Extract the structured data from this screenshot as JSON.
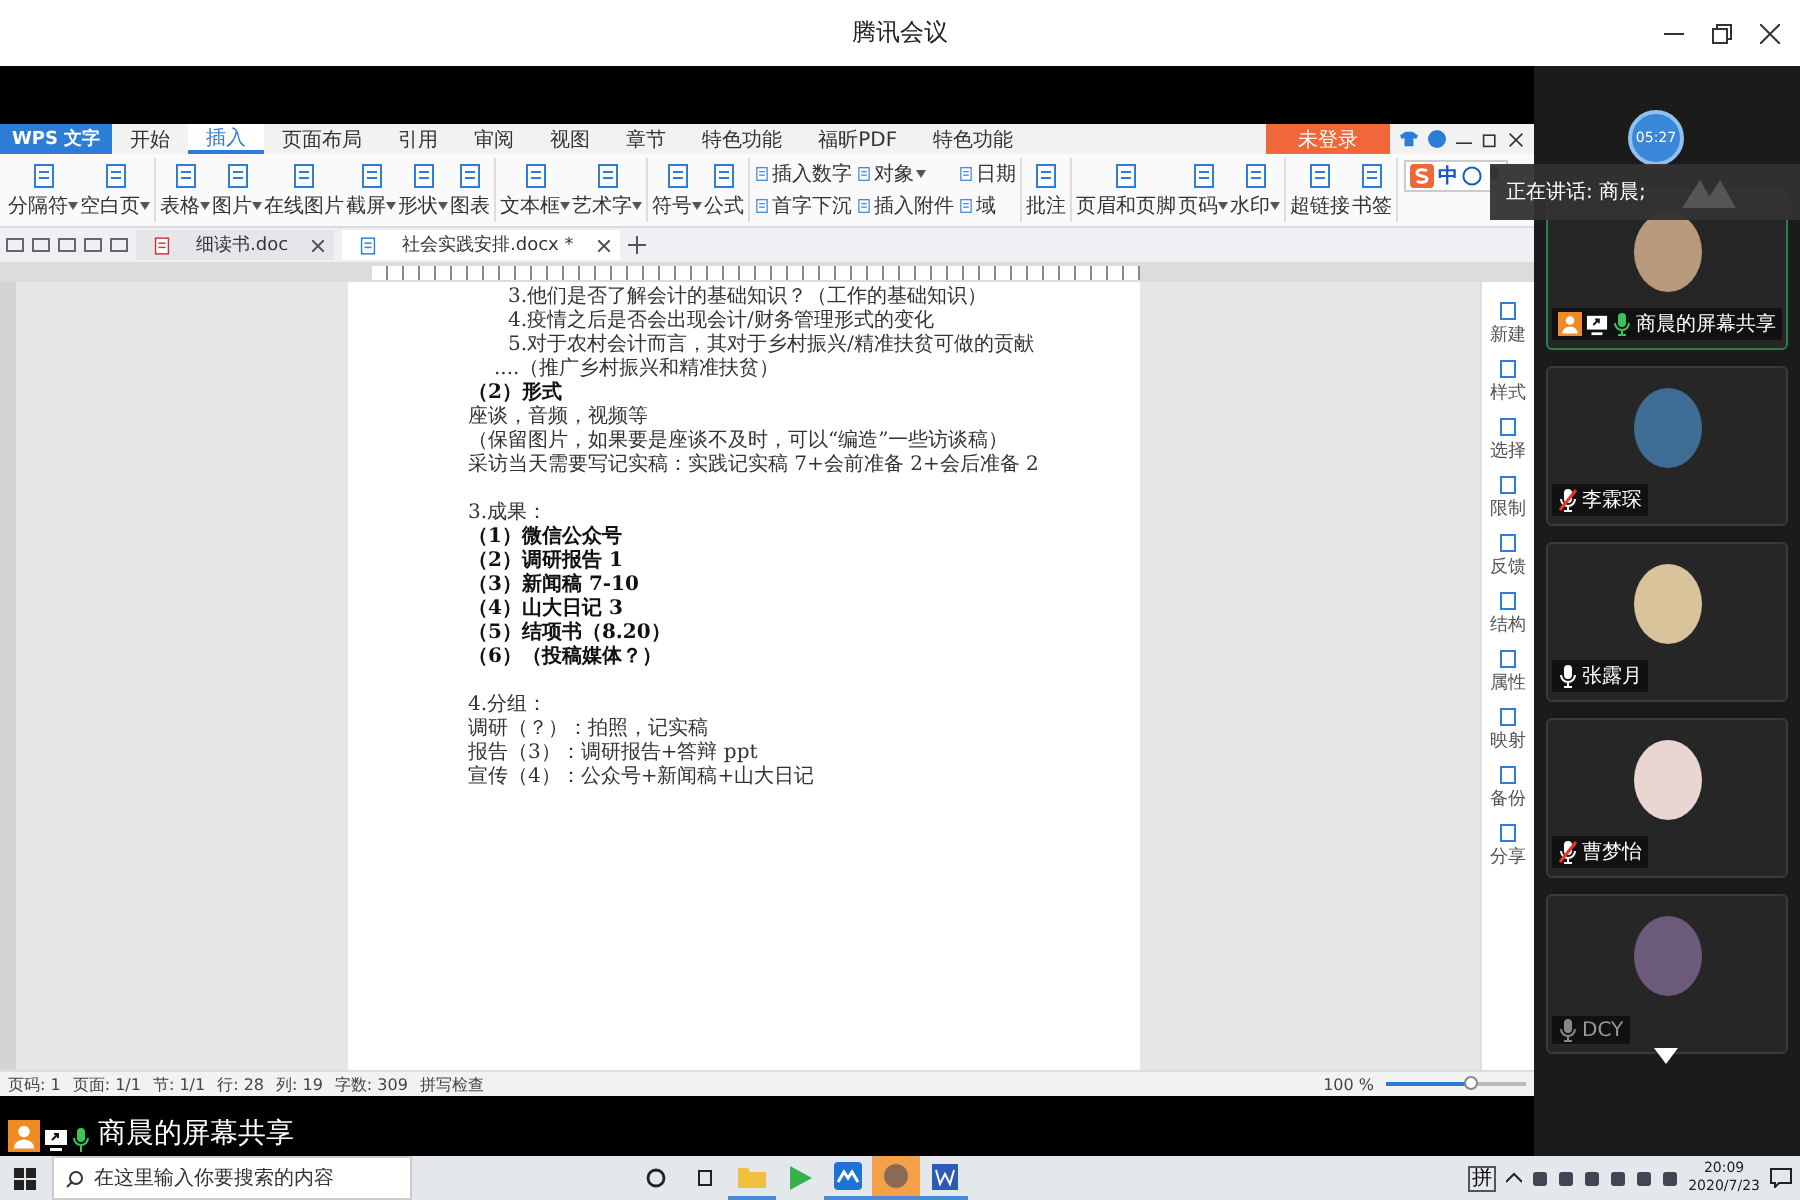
{
  "window": {
    "title": "腾讯会议"
  },
  "wps": {
    "app_tab": "WPS 文字",
    "ribbon_tabs": [
      {
        "label": "开始",
        "selected": false
      },
      {
        "label": "插入",
        "selected": true
      },
      {
        "label": "页面布局",
        "selected": false
      },
      {
        "label": "引用",
        "selected": false
      },
      {
        "label": "审阅",
        "selected": false
      },
      {
        "label": "视图",
        "selected": false
      },
      {
        "label": "章节",
        "selected": false
      },
      {
        "label": "特色功能",
        "selected": false
      },
      {
        "label": "福昕PDF",
        "selected": false
      },
      {
        "label": "特色功能",
        "selected": false
      }
    ],
    "login": "未登录",
    "tool_groups": [
      {
        "kind": "large",
        "items": [
          {
            "label": "分隔符",
            "dropdown": true
          },
          {
            "label": "空白页",
            "dropdown": true
          }
        ]
      },
      {
        "kind": "large",
        "items": [
          {
            "label": "表格",
            "dropdown": true
          },
          {
            "label": "图片",
            "dropdown": true
          },
          {
            "label": "在线图片",
            "dropdown": false
          },
          {
            "label": "截屏",
            "dropdown": true
          },
          {
            "label": "形状",
            "dropdown": true
          },
          {
            "label": "图表",
            "dropdown": false
          }
        ]
      },
      {
        "kind": "large",
        "items": [
          {
            "label": "文本框",
            "dropdown": true
          },
          {
            "label": "艺术字",
            "dropdown": true
          }
        ]
      },
      {
        "kind": "large",
        "items": [
          {
            "label": "符号",
            "dropdown": true
          },
          {
            "label": "公式",
            "dropdown": false
          }
        ]
      },
      {
        "kind": "small",
        "items": [
          {
            "label": "插入数字",
            "dropdown": false
          },
          {
            "label": "对象",
            "dropdown": true
          },
          {
            "label": "日期",
            "dropdown": false
          },
          {
            "label": "首字下沉",
            "dropdown": false
          },
          {
            "label": "插入附件",
            "dropdown": false
          },
          {
            "label": "域",
            "dropdown": false
          }
        ]
      },
      {
        "kind": "large",
        "items": [
          {
            "label": "批注",
            "dropdown": false
          }
        ]
      },
      {
        "kind": "large",
        "items": [
          {
            "label": "页眉和页脚",
            "dropdown": false
          },
          {
            "label": "页码",
            "dropdown": true
          },
          {
            "label": "水印",
            "dropdown": true
          }
        ]
      },
      {
        "kind": "large",
        "items": [
          {
            "label": "超链接",
            "dropdown": false
          },
          {
            "label": "书签",
            "dropdown": false
          }
        ]
      }
    ],
    "ime": {
      "mode": "中"
    },
    "doc_tabs": [
      {
        "label": "细读书.doc",
        "selected": false
      },
      {
        "label": "社会实践安排.docx *",
        "selected": true
      }
    ],
    "document": {
      "lines": [
        {
          "kind": "item",
          "text": "3.他们是否了解会计的基础知识？（工作的基础知识）"
        },
        {
          "kind": "item",
          "text": "4.疫情之后是否会出现会计/财务管理形式的变化"
        },
        {
          "kind": "item",
          "text": "5.对于农村会计而言，其对于乡村振兴/精准扶贫可做的贡献"
        },
        {
          "kind": "sub",
          "text": "....（推广乡村振兴和精准扶贫）"
        },
        {
          "kind": "bold",
          "text": "（2）形式"
        },
        {
          "kind": "body",
          "text": "座谈，音频，视频等"
        },
        {
          "kind": "body",
          "text": "（保留图片，如果要是座谈不及时，可以“编造”一些访谈稿）"
        },
        {
          "kind": "body",
          "text": "采访当天需要写记实稿：实践记实稿 7+会前准备 2+会后准备 2"
        },
        {
          "kind": "heading",
          "text": "3.成果："
        },
        {
          "kind": "bold",
          "text": "（1）微信公众号"
        },
        {
          "kind": "bold",
          "text": "（2）调研报告 1"
        },
        {
          "kind": "bold",
          "text": "（3）新闻稿 7-10"
        },
        {
          "kind": "bold",
          "text": "（4）山大日记 3"
        },
        {
          "kind": "bold",
          "text": "（5）结项书（8.20）"
        },
        {
          "kind": "bold",
          "text": "（6）（投稿媒体？）"
        },
        {
          "kind": "heading",
          "text": "4.分组："
        },
        {
          "kind": "body",
          "text": "调研（？）：拍照，记实稿"
        },
        {
          "kind": "body",
          "text": "报告（3）：调研报告+答辩 ppt"
        },
        {
          "kind": "body",
          "text": "宣传（4）：公众号+新闻稿+山大日记"
        }
      ]
    },
    "side_panel": [
      "新建",
      "样式",
      "选择",
      "限制",
      "反馈",
      "结构",
      "属性",
      "映射",
      "备份",
      "分享"
    ],
    "status": {
      "items": [
        "页码: 1",
        "页面: 1/1",
        "节: 1/1",
        "行: 28",
        "列: 19",
        "字数: 309"
      ],
      "spell_check": "拼写检查",
      "zoom": "100 %",
      "level": 0.6
    }
  },
  "share_label": {
    "text": "商晨的屏幕共享"
  },
  "meeting": {
    "timer": "05:27",
    "speaking": "正在讲话: 商晨;",
    "participants": [
      {
        "name": "商晨的屏幕共享",
        "muted": false,
        "speaking": true,
        "dimmed": false,
        "sharing": true,
        "selected": true
      },
      {
        "name": "李霖琛",
        "muted": true,
        "speaking": false,
        "dimmed": false,
        "sharing": false,
        "selected": false
      },
      {
        "name": "张露月",
        "muted": false,
        "speaking": false,
        "dimmed": false,
        "sharing": false,
        "selected": false
      },
      {
        "name": "曹梦怡",
        "muted": true,
        "speaking": false,
        "dimmed": false,
        "sharing": false,
        "selected": false
      },
      {
        "name": "DCY",
        "muted": false,
        "speaking": false,
        "dimmed": true,
        "sharing": false,
        "selected": false
      }
    ]
  },
  "taskbar": {
    "search_placeholder": "在这里输入你要搜索的内容",
    "ime": "拼",
    "time": "20:09",
    "date": "2020/7/23"
  }
}
